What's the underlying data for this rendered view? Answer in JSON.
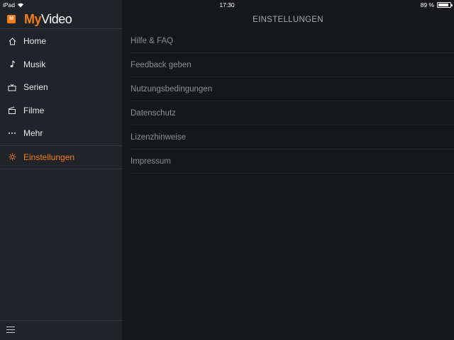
{
  "statusbar": {
    "device": "iPad",
    "time": "17:30",
    "battery_text": "89 %",
    "battery_level": 0.89
  },
  "app": {
    "icon_letter": "M",
    "logo_part1": "My",
    "logo_part2": "Video"
  },
  "sidebar": {
    "items": [
      {
        "label": "Home",
        "icon": "home-icon"
      },
      {
        "label": "Musik",
        "icon": "music-note-icon"
      },
      {
        "label": "Serien",
        "icon": "tv-icon"
      },
      {
        "label": "Filme",
        "icon": "film-clapper-icon"
      },
      {
        "label": "Mehr",
        "icon": "more-dots-icon"
      },
      {
        "label": "Einstellungen",
        "icon": "gear-icon",
        "active": true
      }
    ],
    "footer_icon": "hamburger-menu-icon"
  },
  "main": {
    "title": "EINSTELLUNGEN",
    "items": [
      {
        "label": "Hilfe & FAQ"
      },
      {
        "label": "Feedback geben"
      },
      {
        "label": "Nutzungsbedingungen"
      },
      {
        "label": "Datenschutz"
      },
      {
        "label": "Lizenzhinweise"
      },
      {
        "label": "Impressum"
      }
    ]
  },
  "colors": {
    "accent": "#f27f16",
    "sidebar_bg": "#202327",
    "main_bg": "#15171a",
    "menu_text": "#e9eaec",
    "list_text": "#8d9095"
  }
}
